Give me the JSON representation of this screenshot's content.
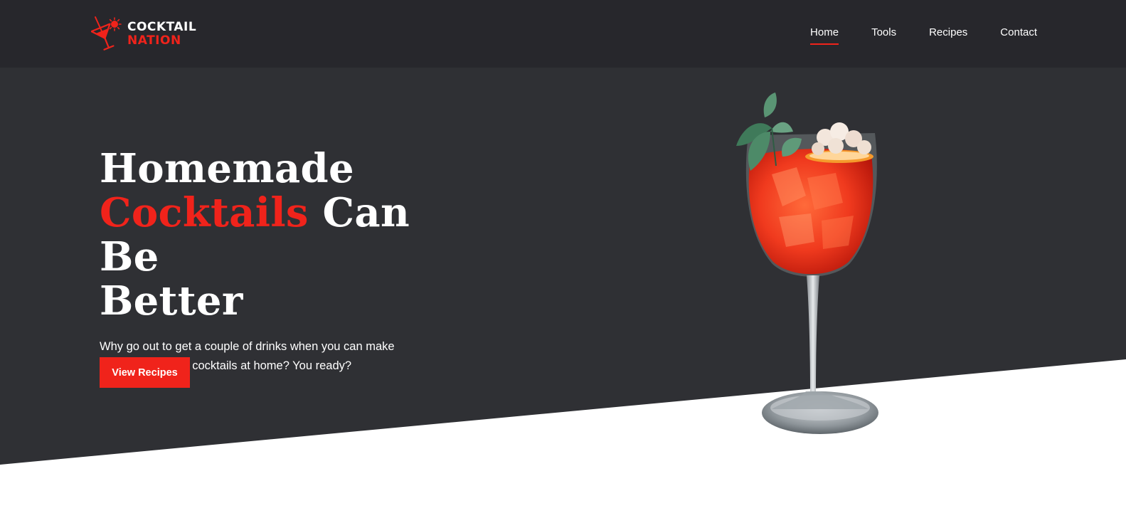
{
  "brand": {
    "line1": "COCKTAIL",
    "line2": "NATION",
    "logo_icon": "cocktail-glass-icon",
    "accent_color": "#f0231b"
  },
  "nav": {
    "items": [
      {
        "label": "Home",
        "active": true
      },
      {
        "label": "Tools",
        "active": false
      },
      {
        "label": "Recipes",
        "active": false
      },
      {
        "label": "Contact",
        "active": false
      }
    ]
  },
  "hero": {
    "headline_part1": "Homemade",
    "headline_accent": "Cocktails",
    "headline_part2": "Can Be",
    "headline_part3": "Better",
    "subtext": "Why go out to get a couple of drinks when you can make your own elegant cocktails at home? You ready?",
    "cta_label": "View Recipes",
    "image": "red-cocktail-glass-image",
    "background_color": "#2f3034"
  }
}
